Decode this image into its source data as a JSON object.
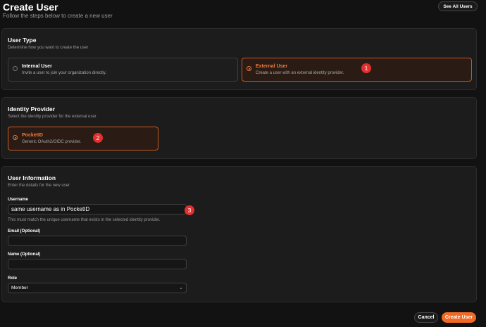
{
  "header": {
    "title": "Create User",
    "subtitle": "Follow the steps below to create a new user",
    "see_all_label": "See All Users"
  },
  "user_type": {
    "title": "User Type",
    "description": "Determine how you want to create the user",
    "options": [
      {
        "title": "Internal User",
        "description": "Invite a user to join your organization directly.",
        "selected": false
      },
      {
        "title": "External User",
        "description": "Create a user with an external identity provider.",
        "selected": true
      }
    ]
  },
  "identity_provider": {
    "title": "Identity Provider",
    "description": "Select the identity provider for the external user",
    "option": {
      "title": "PocketID",
      "description": "Generic OAuth2/OIDC provider.",
      "selected": true
    }
  },
  "user_info": {
    "title": "User Information",
    "description": "Enter the details for the new user",
    "username_label": "Username",
    "username_value": "same username as in PocketID",
    "username_hint": "This must match the unique username that exists in the selected identity provider.",
    "email_label": "Email (Optional)",
    "email_value": "",
    "name_label": "Name (Optional)",
    "name_value": "",
    "role_label": "Role",
    "role_value": "Member"
  },
  "markers": [
    "1",
    "2",
    "3"
  ],
  "footer": {
    "cancel_label": "Cancel",
    "create_label": "Create User"
  },
  "colors": {
    "accent": "#f06a25",
    "marker": "#e23030",
    "background": "#121212",
    "card": "#1c1c1c"
  }
}
